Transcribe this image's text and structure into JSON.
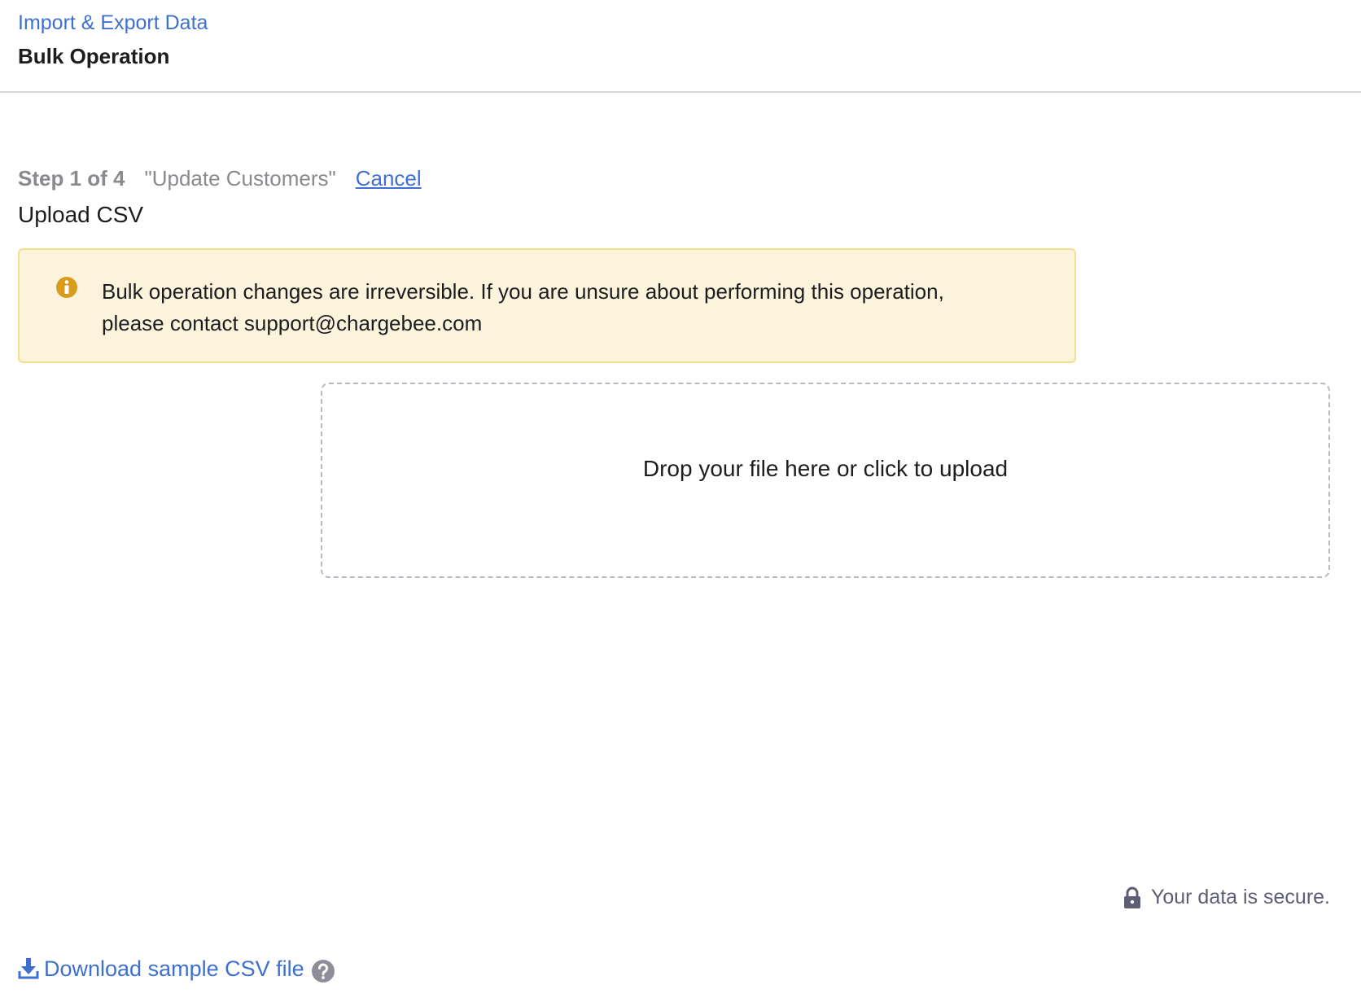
{
  "header": {
    "breadcrumb": "Import & Export Data",
    "title": "Bulk Operation"
  },
  "step": {
    "counter": "Step 1 of 4",
    "operation": "\"Update Customers\"",
    "cancel_label": "Cancel",
    "title": "Upload CSV"
  },
  "alert": {
    "icon": "info-icon",
    "line1": "Bulk operation changes are irreversible. If you are unsure about performing this operation,",
    "line2": "please contact support@chargebee.com",
    "color": "#d99a1e"
  },
  "dropzone": {
    "text": "Drop your file here or click to upload"
  },
  "security": {
    "icon": "lock-icon",
    "text": "Your data is secure."
  },
  "download": {
    "icon": "download-icon",
    "label": "Download sample CSV file",
    "help_icon": "help-icon"
  },
  "colors": {
    "link": "#3f6fd1",
    "alert_bg": "#fcf3dc",
    "alert_border": "#f7dc8e"
  }
}
